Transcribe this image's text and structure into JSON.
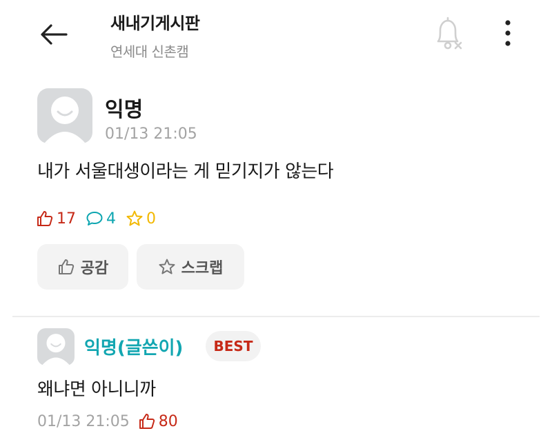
{
  "header": {
    "title": "새내기게시판",
    "subtitle": "연세대 신촌캠"
  },
  "post": {
    "author": "익명",
    "time": "01/13 21:05",
    "body": "내가 서울대생이라는 게 믿기지가 않는다",
    "stats": {
      "likes": "17",
      "comments": "4",
      "scraps": "0"
    },
    "actions": {
      "like_label": "공감",
      "scrap_label": "스크랩"
    }
  },
  "comment": {
    "author": "익명(글쓴이)",
    "badge": "BEST",
    "body": "왜냐면 아니니까",
    "time": "01/13 21:05",
    "likes": "80"
  },
  "colors": {
    "like": "#c62917",
    "comment": "#0ca5b0",
    "scrap": "#f2b800",
    "muted": "#a3a3a3"
  },
  "icons": {
    "back": "arrow-left-icon",
    "bell": "bell-off-icon",
    "more": "more-vertical-icon",
    "like": "thumbs-up-icon",
    "comment": "speech-bubble-icon",
    "scrap": "star-icon"
  }
}
